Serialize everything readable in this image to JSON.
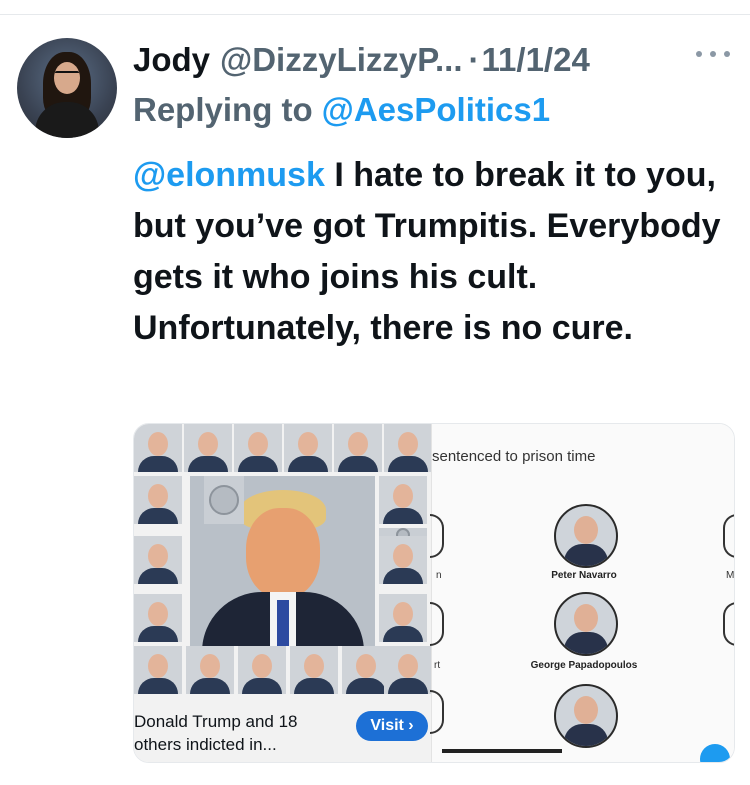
{
  "tweet": {
    "display_name": "Jody",
    "handle": "@DizzyLizzyP...",
    "separator": "·",
    "date": "11/1/24",
    "reply_prefix": "Replying to",
    "reply_to": "@AesPolitics1",
    "mention": "@elonmusk",
    "body": " I hate to break it to you, but you’ve got Trumpitis. Everybody gets it who joins his cult. Unfortunately, there is no cure."
  },
  "media": {
    "ad": {
      "caption": "Donald Trump and 18 others indicted in...",
      "button_label": "Visit ›"
    },
    "right": {
      "title": "sentenced to prison time",
      "people": [
        {
          "name": "Peter Navarro"
        },
        {
          "name": "George Papadopoulos"
        }
      ],
      "fragments": {
        "left_n": "n",
        "left_t": "rt",
        "right_m": "M"
      }
    }
  }
}
